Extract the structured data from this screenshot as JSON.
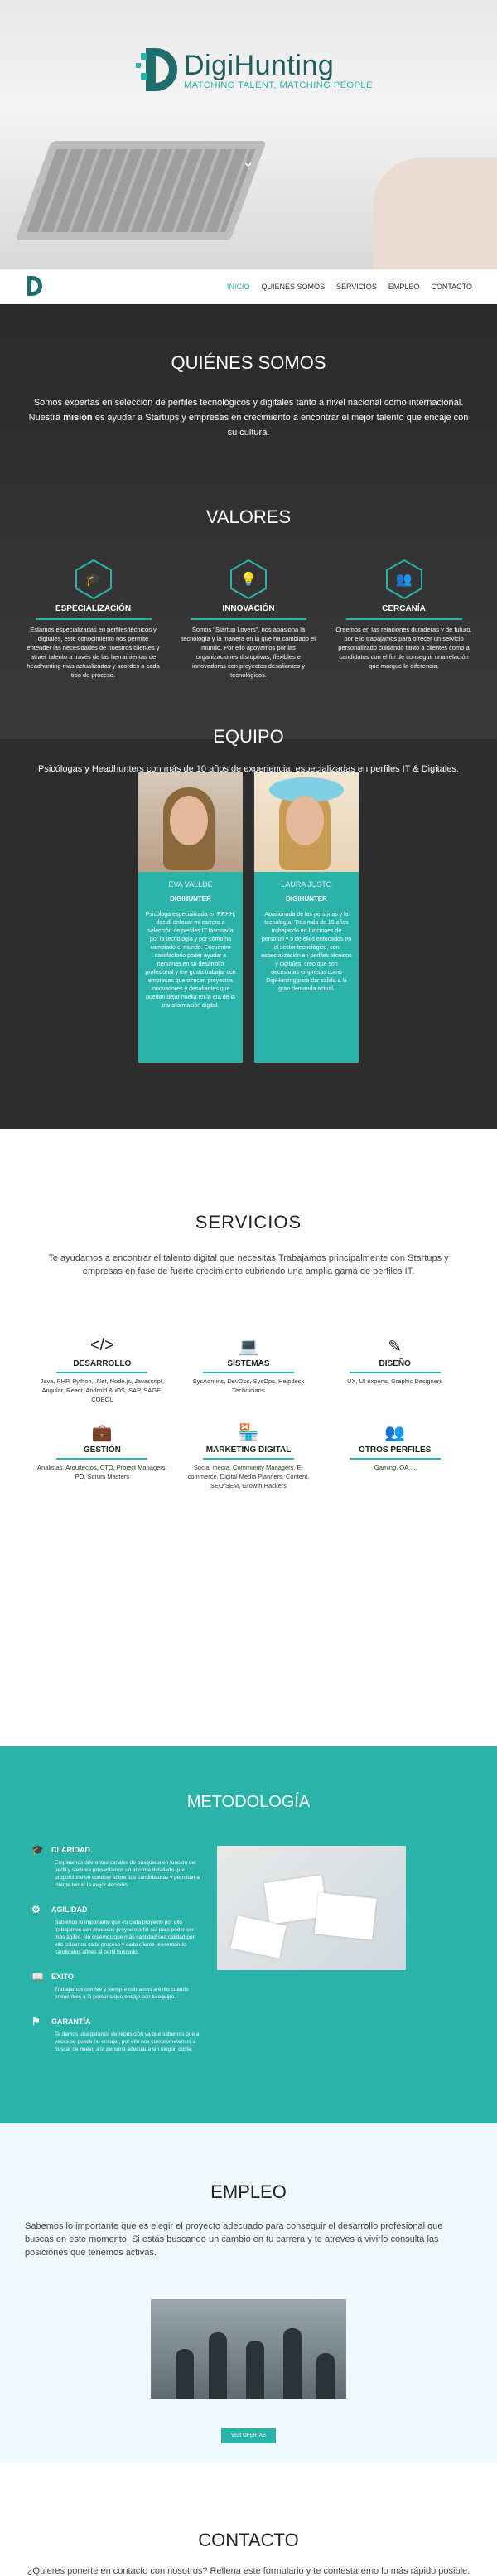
{
  "brand": {
    "name": "DigiHunting",
    "tagline": "MATCHING TALENT, MATCHING PEOPLE"
  },
  "nav": {
    "items": [
      {
        "label": "INICIO",
        "active": true
      },
      {
        "label": "QUIÉNES SOMOS",
        "active": false
      },
      {
        "label": "SERVICIOS",
        "active": false
      },
      {
        "label": "EMPLEO",
        "active": false
      },
      {
        "label": "CONTACTO",
        "active": false
      }
    ]
  },
  "about": {
    "title": "QUIÉNES SOMOS",
    "text_before": "Somos expertas en selección de perfiles tecnológicos y digitales tanto a nivel nacional como internacional. Nuestra ",
    "text_bold": "misión",
    "text_after": " es ayudar a Startups y empresas en crecimiento a encontrar el mejor talento que encaje con su cultura."
  },
  "values": {
    "title": "VALORES",
    "items": [
      {
        "icon": "graduation-cap-icon",
        "title": "ESPECIALIZACIÓN",
        "text": "Estamos especializadas en perfiles técnicos y digitales, este conocimiento nos permite entender las necesidades de nuestros clientes y atraer talento a través de las herramientas de headhunting más actualizadas y acordes a cada tipo de proceso."
      },
      {
        "icon": "lightbulb-icon",
        "title": "INNOVACIÓN",
        "text": "Somos \"Startup Lovers\", nos apasiona la tecnología y la manera en la que ha cambiado el mundo. Por ello apoyamos por las organizaciones disruptivas, flexibles e innovadoras con proyectos desafiantes y tecnológicos."
      },
      {
        "icon": "people-icon",
        "title": "CERCANÍA",
        "text": "Creemos en las relaciones duraderas y de futuro, por ello trabajamos para ofrecer un servicio personalizado cuidando tanto a clientes como a candidatos con el fin de conseguir una relación que marque la diferencia."
      }
    ]
  },
  "team": {
    "title": "EQUIPO",
    "subtitle": "Psicólogas y Headhunters con más de 10 años de experiencia, especializadas en perfiles IT & Digitales.",
    "members": [
      {
        "name": "EVA VALLDE",
        "role": "DIGIHUNTER",
        "text": "Psicóloga especializada en RRHH, decidí enfocar mi carrera a selección de perfiles IT fascinada por la tecnología y por cómo ha cambiado el mundo. Encuentro satisfactorio poder ayudar a personas en su desarrollo profesional y me gusta trabajar con empresas que ofrecen proyectos innovadores y desafiantes que puedan dejar huella en la era de la transformación digital."
      },
      {
        "name": "LAURA JUSTO",
        "role": "DIGIHUNTER",
        "text": "Apasionada de las personas y la tecnología. Tras más de 10 años trabajando en funciones de personal y 5 de ellos enfocados en el sector tecnológico, con especialización en perfiles técnicos y digitales, creo que son necesarias empresas como DigiHunting para dar salida a la gran demanda actual."
      }
    ]
  },
  "services": {
    "title": "SERVICIOS",
    "intro": "Te ayudamos a encontrar el talento digital que necesitas.Trabajamos principalmente con Startups y empresas en fase de fuerte crecimiento cubriendo una amplia gama de perfiles IT.",
    "items": [
      {
        "icon": "code-icon",
        "title": "DESARROLLO",
        "text": "Java, PHP, Python, .Net, Node.js, Javascript, Angular, React, Android & iOS, SAP, SAGE, COBOL"
      },
      {
        "icon": "laptop-icon",
        "title": "SISTEMAS",
        "text": "SysAdmins, DevOps, SysOps, Helpdesk Technicians"
      },
      {
        "icon": "pencil-icon",
        "title": "DISEÑO",
        "text": "UX, UI experts, Graphic Designers"
      },
      {
        "icon": "briefcase-icon",
        "title": "GESTIÓN",
        "text": "Analistas, Arquitectos, CTO, Project Managers, PO, Scrum Masters"
      },
      {
        "icon": "store-icon",
        "title": "MARKETING DIGITAL",
        "text": "Social media, Community Managers, E-commerce, Digital Media Planners, Content, SEO/SEM, Growth Hackers"
      },
      {
        "icon": "users-icon",
        "title": "OTROS PERFILES",
        "text": "Gaming, QA,..."
      }
    ]
  },
  "methodology": {
    "title": "METODOLOGÍA",
    "items": [
      {
        "icon": "graduation-cap-icon",
        "title": "CLARIDAD",
        "text": "Empleamos diferentes canales de búsqueda en función del perfil y siempre presentamos un informe detallado que proporcione un conocer sobre sus candidaturas y permitan al cliente tomar la mejor decisión."
      },
      {
        "icon": "gear-icon",
        "title": "AGILIDAD",
        "text": "Sabemos lo importante que es cada proyecto por ello trabajamos con procesos proyecto a fin así para poder ser más ágiles. No creemos que más cantidad sea calidad por ello cribamos cada proceso y cada cliente presentando candidatos afines al perfil buscado."
      },
      {
        "icon": "book-icon",
        "title": "ÉXITO",
        "text": "Trabajamos con fee y siempre cobramos a éxito cuando encuentres a la persona que encaje con tu equipo."
      },
      {
        "icon": "flag-icon",
        "title": "GARANTÍA",
        "text": "Te damos una garantía de reposición ya que sabemos que a veces se puede no encajar, por ello nos comprometemos a buscar de nuevo a la persona adecuada sin ningún coste."
      }
    ]
  },
  "jobs": {
    "title": "EMPLEO",
    "text": "Sabemos lo importante que es elegir el proyecto adecuado para conseguir el desarrollo profesional que buscas en este momento. Si estás buscando un cambio en tu carrera y te atreves a vivirlo consulta las posiciones que tenemos activas.",
    "button": "VER OFERTAS"
  },
  "contact": {
    "title": "CONTACTO",
    "text": "¿Quieres ponerte en contacto con nosotros? Rellena este formulario y te contestaremo lo más rápido posible."
  },
  "colors": {
    "accent": "#2ab3a9",
    "brand": "#1f6e6b",
    "dark": "#2f2f2f"
  }
}
